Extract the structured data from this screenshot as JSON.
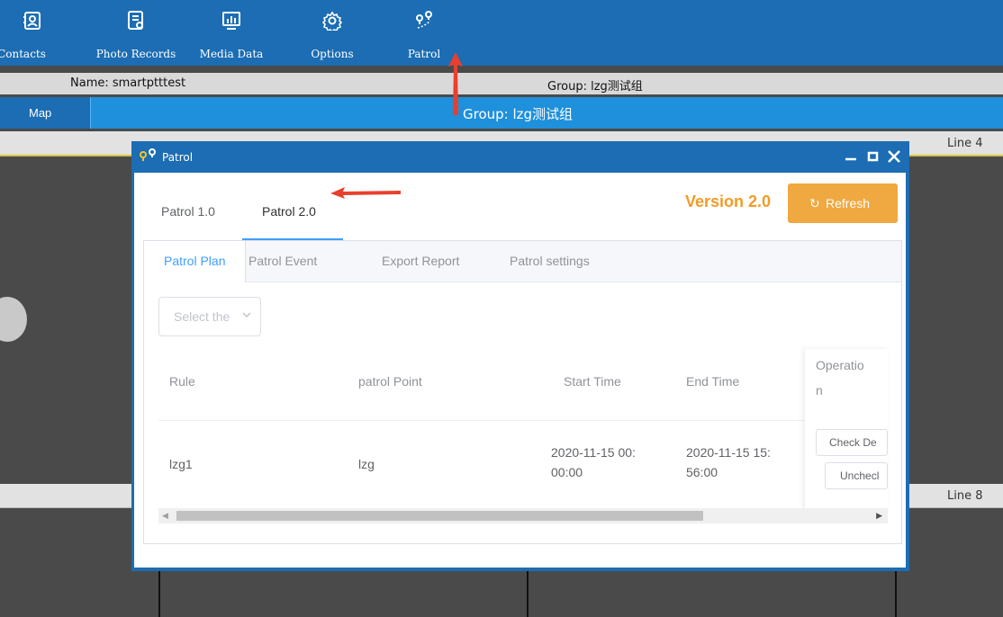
{
  "toolbar": {
    "items": [
      {
        "label": "Contacts",
        "icon": "contacts-icon"
      },
      {
        "label": "Photo Records",
        "icon": "photo-records-icon"
      },
      {
        "label": "Media Data",
        "icon": "media-data-icon"
      },
      {
        "label": "Options",
        "icon": "gear-icon"
      },
      {
        "label": "Patrol",
        "icon": "patrol-icon"
      }
    ]
  },
  "info": {
    "name": "Name: smartptttest",
    "group": "Group: lzg测试组"
  },
  "groupbar": {
    "tab": "Map",
    "title": "Group: lzg测试组"
  },
  "grid": {
    "line4": "Line 4",
    "line8": "Line 8"
  },
  "dialog": {
    "title": "Patrol",
    "top_tabs": [
      "Patrol 1.0",
      "Patrol 2.0"
    ],
    "version": "Version 2.0",
    "refresh_label": "Refresh",
    "sub_tabs": [
      "Patrol Plan",
      "Patrol Event",
      "Export Report",
      "Patrol settings"
    ],
    "select_placeholder": "Select the",
    "table": {
      "headers": {
        "rule": "Rule",
        "point": "patrol Point",
        "start": "Start Time",
        "end": "End Time",
        "op1": "Operatio",
        "op2": "n"
      },
      "row": {
        "rule": "lzg1",
        "point": "lzg",
        "start1": "2020-11-15 00:",
        "start2": "00:00",
        "end1": "2020-11-15 15:",
        "end2": "56:00",
        "btn_check": "Check De",
        "btn_uncheck": "Unchecl"
      }
    }
  },
  "colors": {
    "toolbar": "#1c6db3",
    "groupbar": "#1e90dc",
    "accent": "#409eff",
    "version": "#f39b26",
    "refresh": "#f0a840",
    "arrow": "#e8402e"
  }
}
